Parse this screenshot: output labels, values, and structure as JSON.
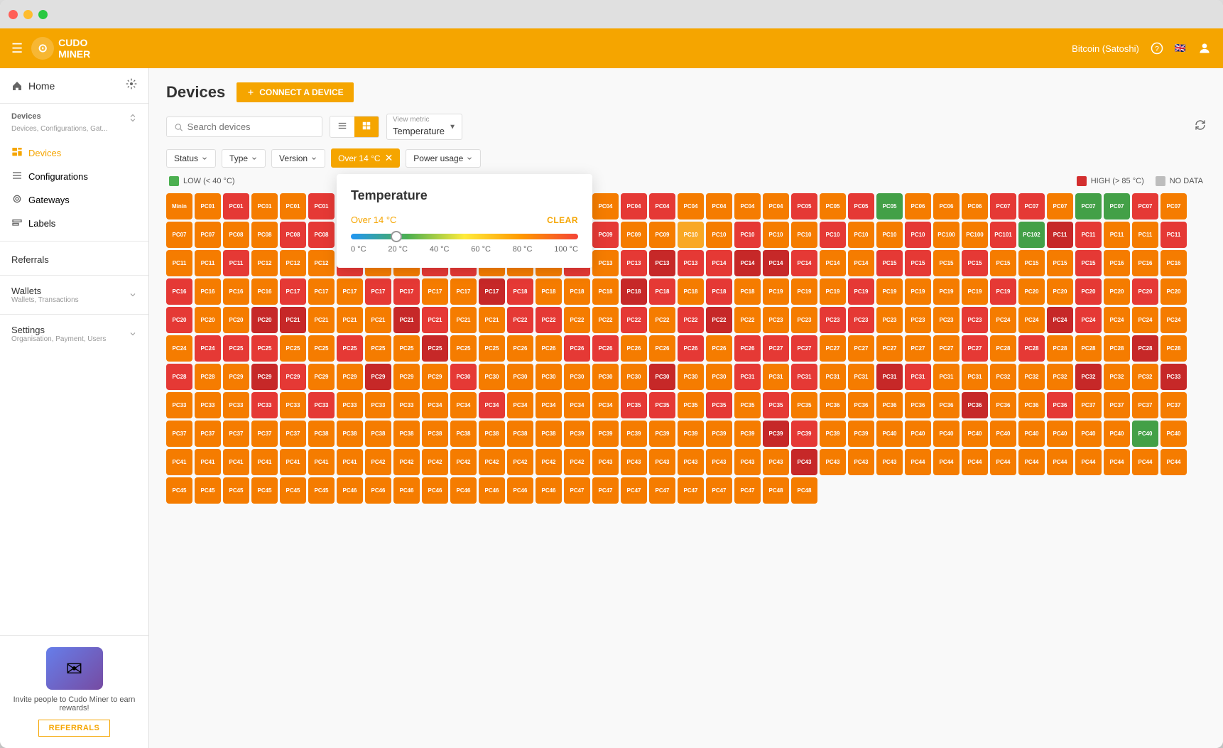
{
  "window": {
    "title": "Cudo Miner"
  },
  "topnav": {
    "menu_icon": "☰",
    "logo_text": "CUDO\nMINER",
    "currency": "Bitcoin (Satoshi)",
    "help_icon": "?",
    "flag_icon": "🇬🇧",
    "user_icon": "👤"
  },
  "sidebar": {
    "home_label": "Home",
    "settings_icon": "⚙",
    "devices_section": {
      "title": "Devices",
      "subtitle": "Devices, Configurations, Gat..."
    },
    "items": [
      {
        "id": "devices",
        "label": "Devices",
        "active": true
      },
      {
        "id": "configurations",
        "label": "Configurations",
        "active": false
      },
      {
        "id": "gateways",
        "label": "Gateways",
        "active": false
      },
      {
        "id": "labels",
        "label": "Labels",
        "active": false
      }
    ],
    "referrals_label": "Referrals",
    "wallets_label": "Wallets",
    "wallets_subtitle": "Wallets, Transactions",
    "settings_label": "Settings",
    "settings_subtitle": "Organisation, Payment, Users",
    "bottom_text": "Invite people to Cudo Miner to earn rewards!",
    "referrals_btn": "REFERRALS"
  },
  "content": {
    "page_title": "Devices",
    "connect_btn": "CONNECT A DEVICE",
    "search_placeholder": "Search devices",
    "view_metric_label": "View metric",
    "view_metric_value": "Temperature",
    "filters": {
      "status": "Status",
      "type": "Type",
      "version": "Version",
      "active_filter": "Over 14 °C",
      "power_usage": "Power usage"
    },
    "temperature_popup": {
      "title": "Temperature",
      "filter_value": "Over 14 °C",
      "clear_label": "CLEAR",
      "slider_min": "0 °C",
      "slider_20": "20 °C",
      "slider_40": "40 °C",
      "slider_60": "60 °C",
      "slider_80": "80 °C",
      "slider_100": "100 °C"
    },
    "legend": {
      "low_label": "LOW (< 40 °C)",
      "high_label": "HIGH (> 85 °C)",
      "no_data_label": "NO DATA"
    },
    "devices": [
      "Minin",
      "PC01",
      "PC01",
      "PC01",
      "PC01",
      "PC01",
      "PC01",
      "PC01",
      "PC01",
      "PC02",
      "PC03",
      "PC03",
      "PC03",
      "PC03",
      "PC03",
      "PC04",
      "PC04",
      "PC04",
      "PC04",
      "PC04",
      "PC04",
      "PC04",
      "PC05",
      "PC05",
      "PC05",
      "PC05",
      "PC06",
      "PC06",
      "PC06",
      "PC07",
      "PC07",
      "PC07",
      "PC07",
      "PC07",
      "PC07",
      "PC07",
      "PC07",
      "PC07",
      "PC08",
      "PC08",
      "PC08",
      "PC08",
      "PC08",
      "PC08",
      "PC08",
      "PC08",
      "PC08",
      "PC09",
      "PC09",
      "PC09",
      "PC09",
      "PC09",
      "PC09",
      "PC09",
      "PC10",
      "PC10",
      "PC10",
      "PC10",
      "PC10",
      "PC10",
      "PC10",
      "PC10",
      "PC10",
      "PC100",
      "PC100",
      "PC101",
      "PC102",
      "PC11",
      "PC11",
      "PC11",
      "PC11",
      "PC11",
      "PC11",
      "PC11",
      "PC11",
      "PC12",
      "PC12",
      "PC12",
      "PC12",
      "PC12",
      "PC12",
      "PC12",
      "PC12",
      "PC12",
      "PC13",
      "PC13",
      "PC13",
      "PC13",
      "PC13",
      "PC13",
      "PC13",
      "PC14",
      "PC14",
      "PC14",
      "PC14",
      "PC14",
      "PC14",
      "PC15",
      "PC15",
      "PC15",
      "PC15",
      "PC15",
      "PC15",
      "PC15",
      "PC15",
      "PC16",
      "PC16",
      "PC16",
      "PC16",
      "PC16",
      "PC16",
      "PC16",
      "PC17",
      "PC17",
      "PC17",
      "PC17",
      "PC17",
      "PC17",
      "PC17",
      "PC17",
      "PC18",
      "PC18",
      "PC18",
      "PC18",
      "PC18",
      "PC18",
      "PC18",
      "PC18",
      "PC18",
      "PC19",
      "PC19",
      "PC19",
      "PC19",
      "PC19",
      "PC19",
      "PC19",
      "PC19",
      "PC19",
      "PC20",
      "PC20",
      "PC20",
      "PC20",
      "PC20",
      "PC20",
      "PC20",
      "PC20",
      "PC20",
      "PC20",
      "PC21",
      "PC21",
      "PC21",
      "PC21",
      "PC21",
      "PC21",
      "PC21",
      "PC21",
      "PC22",
      "PC22",
      "PC22",
      "PC22",
      "PC22",
      "PC22",
      "PC22",
      "PC22",
      "PC22",
      "PC23",
      "PC23",
      "PC23",
      "PC23",
      "PC23",
      "PC23",
      "PC23",
      "PC23",
      "PC24",
      "PC24",
      "PC24",
      "PC24",
      "PC24",
      "PC24",
      "PC24",
      "PC24",
      "PC24",
      "PC25",
      "PC25",
      "PC25",
      "PC25",
      "PC25",
      "PC25",
      "PC25",
      "PC25",
      "PC25",
      "PC25",
      "PC26",
      "PC26",
      "PC26",
      "PC26",
      "PC26",
      "PC26",
      "PC26",
      "PC26",
      "PC26",
      "PC27",
      "PC27",
      "PC27",
      "PC27",
      "PC27",
      "PC27",
      "PC27",
      "PC27",
      "PC28",
      "PC28",
      "PC28",
      "PC28",
      "PC28",
      "PC28",
      "PC28",
      "PC28",
      "PC28",
      "PC29",
      "PC29",
      "PC29",
      "PC29",
      "PC29",
      "PC29",
      "PC29",
      "PC29",
      "PC30",
      "PC30",
      "PC30",
      "PC30",
      "PC30",
      "PC30",
      "PC30",
      "PC30",
      "PC30",
      "PC30",
      "PC31",
      "PC31",
      "PC31",
      "PC31",
      "PC31",
      "PC31",
      "PC31",
      "PC31",
      "PC31",
      "PC32",
      "PC32",
      "PC32",
      "PC32",
      "PC32",
      "PC32",
      "PC33",
      "PC33",
      "PC33",
      "PC33",
      "PC33",
      "PC33",
      "PC33",
      "PC33",
      "PC33",
      "PC33",
      "PC34",
      "PC34",
      "PC34",
      "PC34",
      "PC34",
      "PC34",
      "PC34",
      "PC35",
      "PC35",
      "PC35",
      "PC35",
      "PC35",
      "PC35",
      "PC35",
      "PC36",
      "PC36",
      "PC36",
      "PC36",
      "PC36",
      "PC36",
      "PC36",
      "PC36",
      "PC36",
      "PC37",
      "PC37",
      "PC37",
      "PC37",
      "PC37",
      "PC37",
      "PC37",
      "PC37",
      "PC37",
      "PC38",
      "PC38",
      "PC38",
      "PC38",
      "PC38",
      "PC38",
      "PC38",
      "PC38",
      "PC38",
      "PC39",
      "PC39",
      "PC39",
      "PC39",
      "PC39",
      "PC39",
      "PC39",
      "PC39",
      "PC39",
      "PC39",
      "PC39",
      "PC40",
      "PC40",
      "PC40",
      "PC40",
      "PC40",
      "PC40",
      "PC40",
      "PC40",
      "PC40",
      "PC40",
      "PC40",
      "PC41",
      "PC41",
      "PC41",
      "PC41",
      "PC41",
      "PC41",
      "PC41",
      "PC42",
      "PC42",
      "PC42",
      "PC42",
      "PC42",
      "PC42",
      "PC42",
      "PC42",
      "PC43",
      "PC43",
      "PC43",
      "PC43",
      "PC43",
      "PC43",
      "PC43",
      "PC43",
      "PC43",
      "PC43",
      "PC43",
      "PC44",
      "PC44",
      "PC44",
      "PC44",
      "PC44",
      "PC44",
      "PC44",
      "PC44",
      "PC44",
      "PC44",
      "PC45",
      "PC45",
      "PC45",
      "PC45",
      "PC45",
      "PC45",
      "PC46",
      "PC46",
      "PC46",
      "PC46",
      "PC46",
      "PC46",
      "PC46",
      "PC46",
      "PC47",
      "PC47",
      "PC47",
      "PC47",
      "PC47",
      "PC47",
      "PC47",
      "PC48",
      "PC48"
    ],
    "device_colors": [
      "c-orange",
      "c-orange",
      "c-red2",
      "c-orange",
      "c-orange",
      "c-red2",
      "c-red",
      "c-orange",
      "c-orange",
      "c-red2",
      "c-red2",
      "c-orange",
      "c-red2",
      "c-red2",
      "c-orange",
      "c-orange",
      "c-red2",
      "c-red2",
      "c-orange",
      "c-orange",
      "c-orange",
      "c-orange",
      "c-red2",
      "c-orange",
      "c-red2",
      "c-green",
      "c-orange",
      "c-orange",
      "c-orange",
      "c-red2",
      "c-red2",
      "c-orange",
      "c-green",
      "c-red2",
      "c-red2",
      "c-orange",
      "c-orange",
      "c-orange",
      "c-orange",
      "c-orange",
      "c-red2",
      "c-red2",
      "c-orange",
      "c-orange",
      "c-orange",
      "c-red2",
      "c-orange",
      "c-orange",
      "c-red2",
      "c-orange",
      "c-red2",
      "c-red2",
      "c-orange",
      "c-orange",
      "c-yellow",
      "c-orange",
      "c-red2",
      "c-orange",
      "c-orange",
      "c-red2",
      "c-orange",
      "c-orange",
      "c-red2",
      "c-orange",
      "c-orange",
      "c-red2",
      "c-red",
      "c-red",
      "c-red2",
      "c-orange",
      "c-orange",
      "c-red2",
      "c-orange",
      "c-orange",
      "c-red2",
      "c-orange",
      "c-orange",
      "c-orange",
      "c-red2",
      "c-orange",
      "c-orange",
      "c-red2",
      "c-red2",
      "c-orange",
      "c-orange",
      "c-orange",
      "c-red2",
      "c-orange",
      "c-red2",
      "c-red",
      "c-red2",
      "c-red2",
      "c-red",
      "c-red",
      "c-red2",
      "c-orange",
      "c-orange",
      "c-red2",
      "c-red2",
      "c-orange",
      "c-red2",
      "c-orange",
      "c-orange",
      "c-orange",
      "c-red2",
      "c-orange",
      "c-orange",
      "c-orange",
      "c-red2",
      "c-orange",
      "c-orange",
      "c-orange",
      "c-red2",
      "c-orange",
      "c-orange",
      "c-red2",
      "c-red2",
      "c-orange",
      "c-orange",
      "c-red",
      "c-red2",
      "c-orange",
      "c-orange",
      "c-orange",
      "c-red",
      "c-red2",
      "c-orange",
      "c-red2",
      "c-orange",
      "c-orange",
      "c-orange",
      "c-orange",
      "c-red2",
      "c-orange",
      "c-orange",
      "c-orange",
      "c-orange",
      "c-red2",
      "c-orange",
      "c-orange",
      "c-red2",
      "c-orange",
      "c-red2",
      "c-orange",
      "c-red2",
      "c-orange",
      "c-orange",
      "c-red",
      "c-red",
      "c-orange",
      "c-orange",
      "c-orange",
      "c-red",
      "c-red2",
      "c-orange",
      "c-orange",
      "c-red2",
      "c-red2",
      "c-orange",
      "c-orange",
      "c-red2",
      "c-orange",
      "c-red2",
      "c-red",
      "c-orange",
      "c-orange",
      "c-orange",
      "c-red2",
      "c-red2",
      "c-orange",
      "c-orange",
      "c-orange",
      "c-red2",
      "c-orange",
      "c-orange",
      "c-red",
      "c-red2",
      "c-orange",
      "c-orange",
      "c-orange",
      "c-orange",
      "c-red2",
      "c-red2",
      "c-red2",
      "c-orange",
      "c-orange",
      "c-red2",
      "c-orange",
      "c-orange",
      "c-red",
      "c-orange",
      "c-orange",
      "c-orange",
      "c-orange",
      "c-red2",
      "c-red2",
      "c-orange",
      "c-orange",
      "c-red2",
      "c-orange",
      "c-red2",
      "c-red2",
      "c-red2",
      "c-orange",
      "c-orange",
      "c-orange",
      "c-orange",
      "c-orange",
      "c-red2",
      "c-orange",
      "c-red2",
      "c-orange",
      "c-orange",
      "c-orange",
      "c-red",
      "c-orange",
      "c-red2",
      "c-orange",
      "c-orange",
      "c-red",
      "c-red2",
      "c-orange",
      "c-orange",
      "c-red",
      "c-orange",
      "c-orange",
      "c-red2",
      "c-orange",
      "c-orange",
      "c-orange",
      "c-orange",
      "c-orange",
      "c-orange",
      "c-red",
      "c-orange",
      "c-orange",
      "c-red2",
      "c-orange",
      "c-red2",
      "c-orange",
      "c-orange",
      "c-red",
      "c-red2",
      "c-orange",
      "c-orange",
      "c-orange",
      "c-orange",
      "c-orange",
      "c-red",
      "c-orange",
      "c-orange",
      "c-red",
      "c-orange",
      "c-orange",
      "c-orange",
      "c-red2",
      "c-orange",
      "c-red2",
      "c-orange",
      "c-orange",
      "c-orange",
      "c-orange",
      "c-orange",
      "c-red2",
      "c-orange",
      "c-orange",
      "c-orange",
      "c-orange",
      "c-red2",
      "c-red2",
      "c-orange",
      "c-red2",
      "c-orange",
      "c-red2",
      "c-orange",
      "c-orange",
      "c-orange",
      "c-orange",
      "c-orange",
      "c-orange",
      "c-red",
      "c-orange",
      "c-orange",
      "c-red2",
      "c-orange",
      "c-orange",
      "c-orange",
      "c-orange",
      "c-orange",
      "c-orange",
      "c-orange",
      "c-orange",
      "c-orange",
      "c-orange",
      "c-orange",
      "c-orange",
      "c-orange",
      "c-orange",
      "c-orange",
      "c-orange",
      "c-orange",
      "c-orange",
      "c-orange",
      "c-orange",
      "c-orange",
      "c-orange",
      "c-orange",
      "c-orange",
      "c-orange",
      "c-red",
      "c-red2",
      "c-orange",
      "c-orange",
      "c-orange",
      "c-orange",
      "c-orange",
      "c-orange",
      "c-orange",
      "c-orange",
      "c-orange",
      "c-orange",
      "c-orange",
      "c-green",
      "c-orange",
      "c-orange",
      "c-orange",
      "c-orange",
      "c-orange",
      "c-orange",
      "c-orange",
      "c-orange",
      "c-orange",
      "c-orange",
      "c-orange",
      "c-orange",
      "c-orange",
      "c-orange",
      "c-orange",
      "c-orange",
      "c-orange",
      "c-orange",
      "c-orange",
      "c-orange",
      "c-orange",
      "c-orange",
      "c-orange",
      "c-red",
      "c-orange",
      "c-orange",
      "c-orange",
      "c-orange",
      "c-orange",
      "c-orange",
      "c-orange",
      "c-orange",
      "c-orange",
      "c-orange",
      "c-orange",
      "c-orange",
      "c-orange",
      "c-orange",
      "c-orange",
      "c-orange"
    ]
  }
}
